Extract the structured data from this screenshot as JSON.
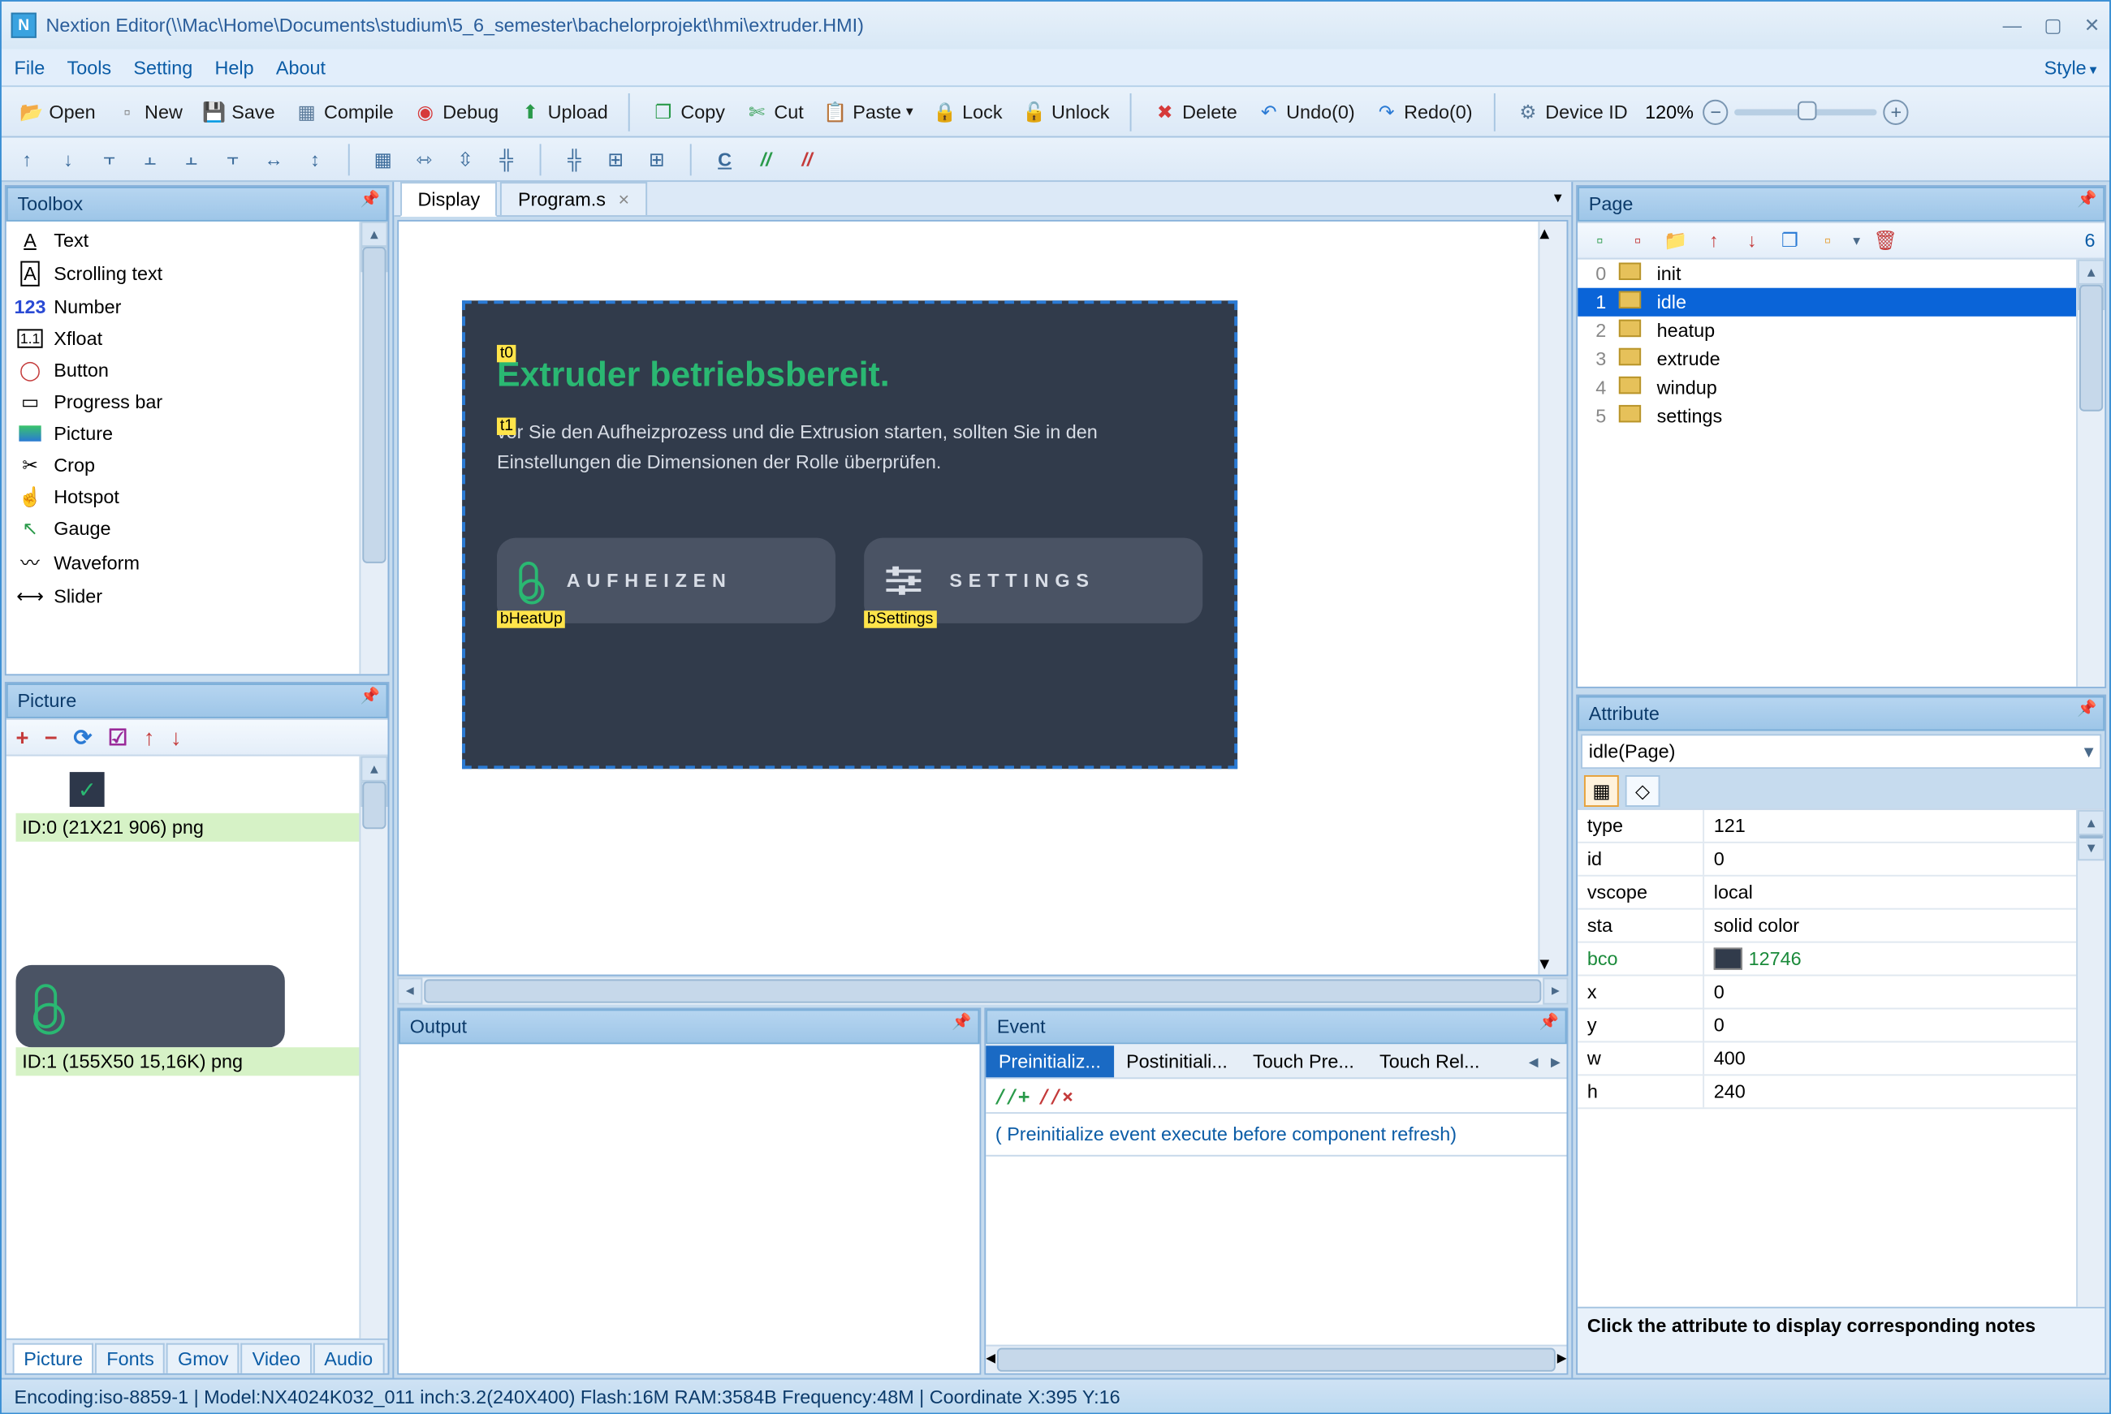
{
  "window": {
    "title": "Nextion Editor(\\\\Mac\\Home\\Documents\\studium\\5_6_semester\\bachelorprojekt\\hmi\\extruder.HMI)"
  },
  "menu": {
    "file": "File",
    "tools": "Tools",
    "setting": "Setting",
    "help": "Help",
    "about": "About",
    "style": "Style"
  },
  "toolbar": {
    "open": "Open",
    "new": "New",
    "save": "Save",
    "compile": "Compile",
    "debug": "Debug",
    "upload": "Upload",
    "copy": "Copy",
    "cut": "Cut",
    "paste": "Paste",
    "lock": "Lock",
    "unlock": "Unlock",
    "delete": "Delete",
    "undo": "Undo(0)",
    "redo": "Redo(0)",
    "device_id": "Device ID",
    "zoom": "120%"
  },
  "toolbox": {
    "title": "Toolbox",
    "items": [
      "Text",
      "Scrolling text",
      "Number",
      "Xfloat",
      "Button",
      "Progress bar",
      "Picture",
      "Crop",
      "Hotspot",
      "Gauge",
      "Waveform",
      "Slider"
    ]
  },
  "picture_panel": {
    "title": "Picture",
    "tabs": [
      "Picture",
      "Fonts",
      "Gmov",
      "Video",
      "Audio"
    ],
    "items": [
      {
        "label": "ID:0  (21X21 906) png"
      },
      {
        "label": "ID:1  (155X50 15,16K) png"
      }
    ]
  },
  "center": {
    "tabs": {
      "display": "Display",
      "programs": "Program.s"
    },
    "canvas": {
      "t0": "t0",
      "t1": "t1",
      "bHeatUp": "bHeatUp",
      "bSettings": "bSettings",
      "title": "Extruder betriebsbereit.",
      "text": "vor Sie den Aufheizprozess und die Extrusion starten, sollten Sie in den Einstellungen die Dimensionen der Rolle überprüfen.",
      "btn_heat": "AUFHEIZEN",
      "btn_settings": "SETTINGS"
    },
    "output": {
      "title": "Output"
    },
    "event": {
      "title": "Event",
      "tabs": [
        "Preinitializ...",
        "Postinitiali...",
        "Touch Pre...",
        "Touch Rel..."
      ],
      "hint": "( Preinitialize event execute before component refresh)"
    }
  },
  "page_panel": {
    "title": "Page",
    "count": "6",
    "items": [
      {
        "idx": "0",
        "name": "init"
      },
      {
        "idx": "1",
        "name": "idle"
      },
      {
        "idx": "2",
        "name": "heatup"
      },
      {
        "idx": "3",
        "name": "extrude"
      },
      {
        "idx": "4",
        "name": "windup"
      },
      {
        "idx": "5",
        "name": "settings"
      }
    ],
    "selected": 1
  },
  "attribute_panel": {
    "title": "Attribute",
    "selector": "idle(Page)",
    "rows": [
      {
        "key": "type",
        "val": "121"
      },
      {
        "key": "id",
        "val": "0"
      },
      {
        "key": "vscope",
        "val": "local"
      },
      {
        "key": "sta",
        "val": "solid color"
      },
      {
        "key": "bco",
        "val": "12746",
        "green": true,
        "color": "#313b4b"
      },
      {
        "key": "x",
        "val": "0"
      },
      {
        "key": "y",
        "val": "0"
      },
      {
        "key": "w",
        "val": "400"
      },
      {
        "key": "h",
        "val": "240"
      }
    ],
    "hint": "Click the attribute to display corresponding notes"
  },
  "statusbar": {
    "text": "Encoding:iso-8859-1 | Model:NX4024K032_011 inch:3.2(240X400) Flash:16M RAM:3584B Frequency:48M |   Coordinate X:395  Y:16"
  }
}
